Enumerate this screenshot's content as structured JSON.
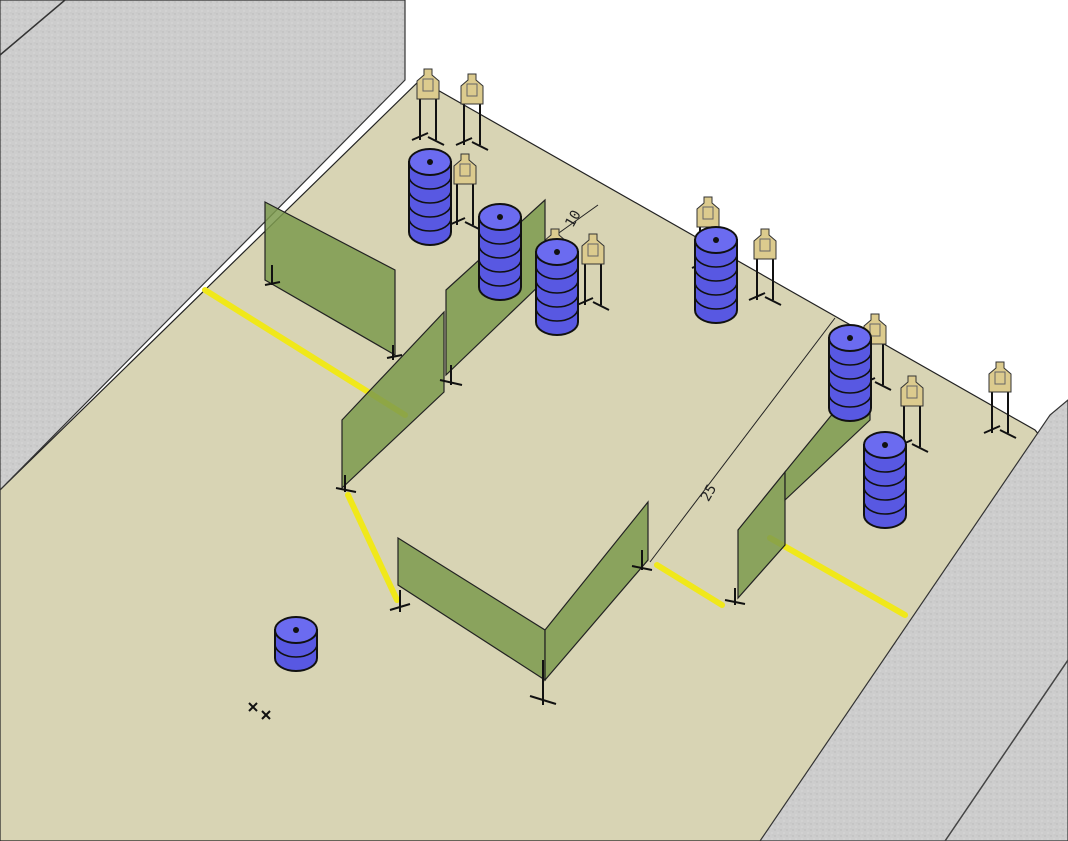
{
  "floor_labels": [
    "10",
    "25"
  ],
  "colors": {
    "floor": "#d8d4b4",
    "berm": "#cfcfcf",
    "wall_panel": "#7d9a4e",
    "fault_line": "#f0e81a",
    "barrel": "#5858e2",
    "target": "#dccb8e"
  },
  "icons": [
    "start-position-marker-icon"
  ]
}
